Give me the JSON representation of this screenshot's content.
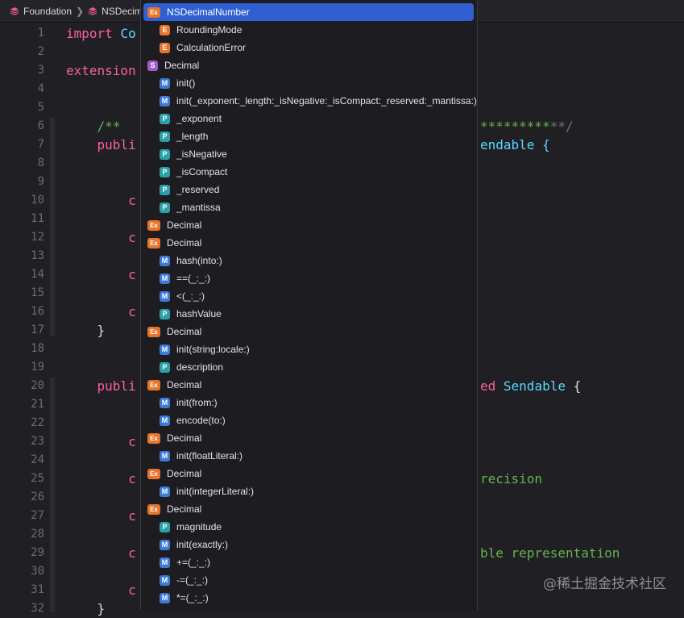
{
  "breadcrumb": {
    "items": [
      {
        "label": "Foundation",
        "icon": "package-icon"
      },
      {
        "label": "NSDecima",
        "icon": "package-icon"
      }
    ]
  },
  "colors": {
    "keyword": "#fc5fa3",
    "type": "#5dd8ff",
    "comment": "#6c7986",
    "doc_comment": "#67b350",
    "string": "#67b350",
    "plain": "#dfdfe0",
    "selected": "#2f5fd0",
    "badge_m": "#3d7bd9",
    "badge_p": "#2aa0a8",
    "badge_e": "#e8742c",
    "badge_s": "#a459c9",
    "badge_ex": "#e8742c"
  },
  "editor": {
    "lines": [
      {
        "n": "1",
        "segments": [
          {
            "t": "import ",
            "c": "keyword"
          },
          {
            "t": "Co",
            "c": "type"
          }
        ]
      },
      {
        "n": "2",
        "segments": []
      },
      {
        "n": "3",
        "segments": [
          {
            "t": "extension",
            "c": "keyword"
          }
        ]
      },
      {
        "n": "4",
        "segments": []
      },
      {
        "n": "5",
        "segments": []
      },
      {
        "n": "6",
        "segments": [
          {
            "t": "    /**",
            "c": "doc_comment"
          }
        ]
      },
      {
        "n": "7",
        "segments": [
          {
            "t": "    publi",
            "c": "keyword"
          }
        ]
      },
      {
        "n": "8",
        "segments": []
      },
      {
        "n": "9",
        "segments": []
      },
      {
        "n": "10",
        "segments": [
          {
            "t": "        c",
            "c": "keyword"
          }
        ]
      },
      {
        "n": "11",
        "segments": []
      },
      {
        "n": "12",
        "segments": [
          {
            "t": "        c",
            "c": "keyword"
          }
        ]
      },
      {
        "n": "13",
        "segments": []
      },
      {
        "n": "14",
        "segments": [
          {
            "t": "        c",
            "c": "keyword"
          }
        ]
      },
      {
        "n": "15",
        "segments": []
      },
      {
        "n": "16",
        "segments": [
          {
            "t": "        c",
            "c": "keyword"
          }
        ]
      },
      {
        "n": "17",
        "segments": [
          {
            "t": "    }",
            "c": "plain"
          }
        ]
      },
      {
        "n": "18",
        "segments": []
      },
      {
        "n": "19",
        "segments": []
      },
      {
        "n": "20",
        "segments": [
          {
            "t": "    publi",
            "c": "keyword"
          }
        ]
      },
      {
        "n": "21",
        "segments": []
      },
      {
        "n": "22",
        "segments": []
      },
      {
        "n": "23",
        "segments": [
          {
            "t": "        c",
            "c": "keyword"
          }
        ]
      },
      {
        "n": "24",
        "segments": []
      },
      {
        "n": "25",
        "segments": [
          {
            "t": "        c",
            "c": "keyword"
          }
        ]
      },
      {
        "n": "26",
        "segments": []
      },
      {
        "n": "27",
        "segments": [
          {
            "t": "        c",
            "c": "keyword"
          }
        ]
      },
      {
        "n": "28",
        "segments": []
      },
      {
        "n": "29",
        "segments": [
          {
            "t": "        c",
            "c": "keyword"
          }
        ]
      },
      {
        "n": "30",
        "segments": []
      },
      {
        "n": "31",
        "segments": [
          {
            "t": "        c",
            "c": "keyword"
          }
        ]
      },
      {
        "n": "32",
        "segments": [
          {
            "t": "    }",
            "c": "plain"
          }
        ]
      }
    ],
    "right_fragments": [
      {
        "line": "6",
        "segments": [
          {
            "t": "*********",
            "c": "doc_comment"
          },
          {
            "t": "**/",
            "c": "comment"
          }
        ]
      },
      {
        "line": "7",
        "segments": [
          {
            "t": "endable {",
            "c": "type"
          }
        ]
      },
      {
        "line": "20",
        "segments": [
          {
            "t": "ed ",
            "c": "keyword"
          },
          {
            "t": "Sendable",
            "c": "type"
          },
          {
            "t": " {",
            "c": "plain"
          }
        ]
      },
      {
        "line": "25",
        "segments": [
          {
            "t": "recision",
            "c": "string"
          }
        ]
      },
      {
        "line": "29",
        "segments": [
          {
            "t": "ble representation",
            "c": "string"
          }
        ]
      }
    ]
  },
  "completions": [
    {
      "kind": "Ex",
      "label": "NSDecimalNumber",
      "indent": 0,
      "selected": true
    },
    {
      "kind": "E",
      "label": "RoundingMode",
      "indent": 1
    },
    {
      "kind": "E",
      "label": "CalculationError",
      "indent": 1
    },
    {
      "kind": "S",
      "label": "Decimal",
      "indent": 0
    },
    {
      "kind": "M",
      "label": "init()",
      "indent": 1
    },
    {
      "kind": "M",
      "label": "init(_exponent:_length:_isNegative:_isCompact:_reserved:_mantissa:)",
      "indent": 1
    },
    {
      "kind": "P",
      "label": "_exponent",
      "indent": 1
    },
    {
      "kind": "P",
      "label": "_length",
      "indent": 1
    },
    {
      "kind": "P",
      "label": "_isNegative",
      "indent": 1
    },
    {
      "kind": "P",
      "label": "_isCompact",
      "indent": 1
    },
    {
      "kind": "P",
      "label": "_reserved",
      "indent": 1
    },
    {
      "kind": "P",
      "label": "_mantissa",
      "indent": 1
    },
    {
      "kind": "Ex",
      "label": "Decimal",
      "indent": 0
    },
    {
      "kind": "Ex",
      "label": "Decimal",
      "indent": 0
    },
    {
      "kind": "M",
      "label": "hash(into:)",
      "indent": 1
    },
    {
      "kind": "M",
      "label": "==(_:_:)",
      "indent": 1
    },
    {
      "kind": "M",
      "label": "<(_:_:)",
      "indent": 1
    },
    {
      "kind": "P",
      "label": "hashValue",
      "indent": 1
    },
    {
      "kind": "Ex",
      "label": "Decimal",
      "indent": 0
    },
    {
      "kind": "M",
      "label": "init(string:locale:)",
      "indent": 1
    },
    {
      "kind": "P",
      "label": "description",
      "indent": 1
    },
    {
      "kind": "Ex",
      "label": "Decimal",
      "indent": 0
    },
    {
      "kind": "M",
      "label": "init(from:)",
      "indent": 1
    },
    {
      "kind": "M",
      "label": "encode(to:)",
      "indent": 1
    },
    {
      "kind": "Ex",
      "label": "Decimal",
      "indent": 0
    },
    {
      "kind": "M",
      "label": "init(floatLiteral:)",
      "indent": 1
    },
    {
      "kind": "Ex",
      "label": "Decimal",
      "indent": 0
    },
    {
      "kind": "M",
      "label": "init(integerLiteral:)",
      "indent": 1
    },
    {
      "kind": "Ex",
      "label": "Decimal",
      "indent": 0
    },
    {
      "kind": "P",
      "label": "magnitude",
      "indent": 1
    },
    {
      "kind": "M",
      "label": "init(exactly:)",
      "indent": 1
    },
    {
      "kind": "M",
      "label": "+=(_:_:)",
      "indent": 1
    },
    {
      "kind": "M",
      "label": "-=(_:_:)",
      "indent": 1
    },
    {
      "kind": "M",
      "label": "*=(_:_:)",
      "indent": 1
    }
  ],
  "watermark": "@稀土掘金技术社区"
}
